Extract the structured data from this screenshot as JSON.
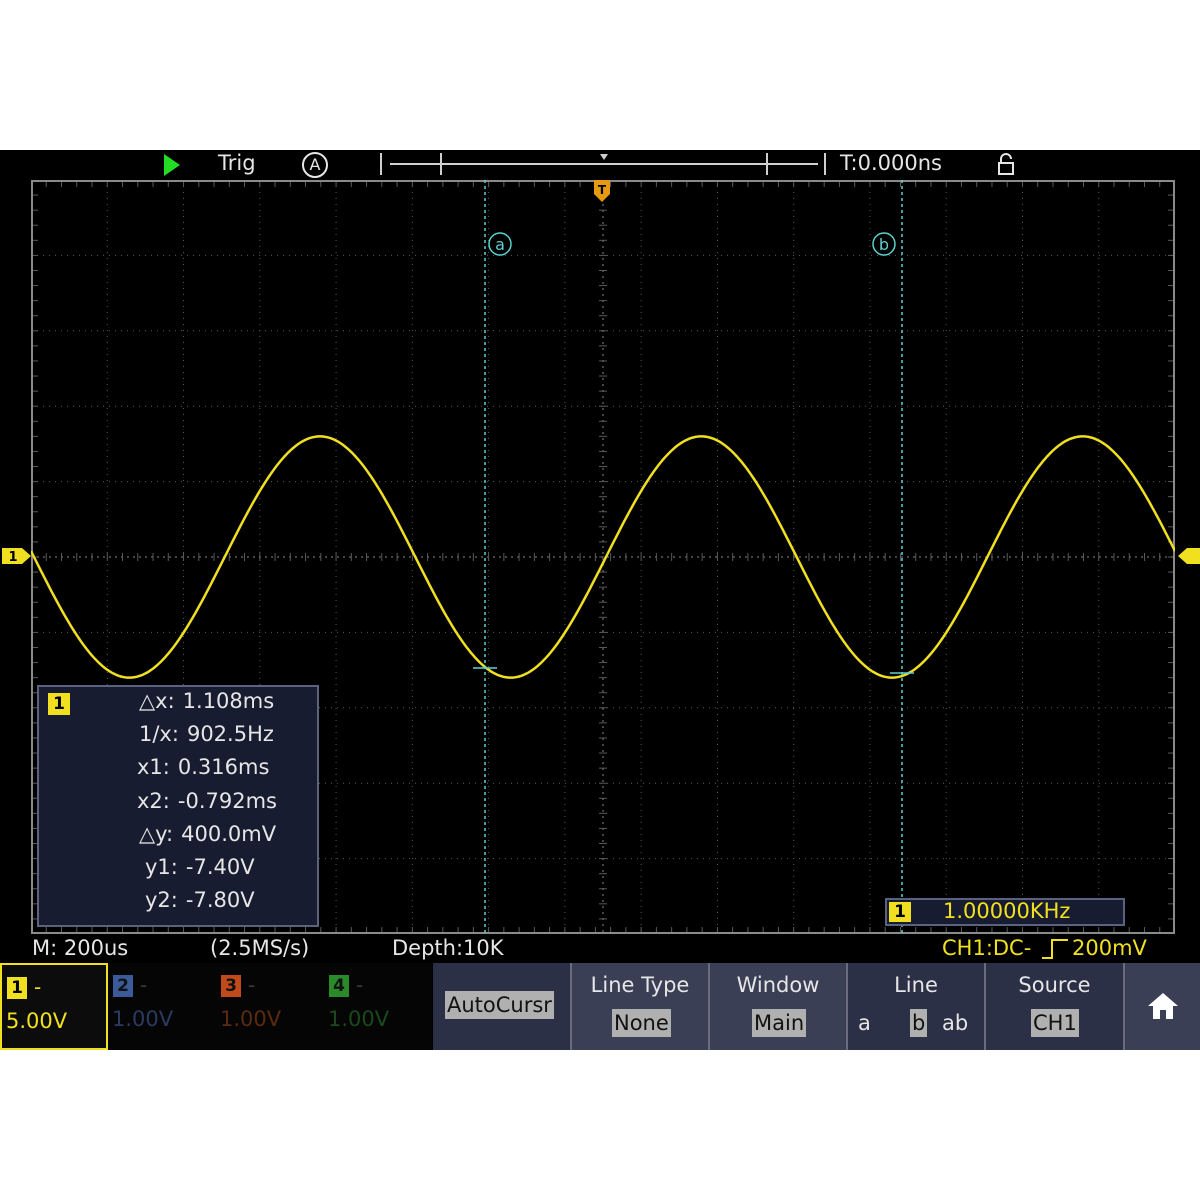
{
  "top_bar": {
    "trig_label": "Trig",
    "trig_mode_icon": "A",
    "time_delay": "T:0.000ns"
  },
  "cursors": {
    "a_label": "a",
    "b_label": "b"
  },
  "trigger_marker": "T",
  "channel_marker": "1",
  "measurement": {
    "channel": "1",
    "rows": [
      {
        "label": "△x:",
        "value": "1.108ms"
      },
      {
        "label": "1/x:",
        "value": "902.5Hz"
      },
      {
        "label": "x1:",
        "value": "0.316ms"
      },
      {
        "label": "x2:",
        "value": "-0.792ms"
      },
      {
        "label": "△y:",
        "value": "400.0mV"
      },
      {
        "label": "y1:",
        "value": "-7.40V"
      },
      {
        "label": "y2:",
        "value": "-7.80V"
      }
    ]
  },
  "frequency": {
    "channel": "1",
    "value": "1.00000KHz"
  },
  "status": {
    "timebase": "M: 200us",
    "sample_rate": "(2.5MS/s)",
    "depth": "Depth:10K",
    "trigger_prefix": "CH1:DC-",
    "trigger_level": "200mV"
  },
  "channels": [
    {
      "num": "1",
      "dash": "-",
      "value": "5.00V",
      "color": "#f0e020",
      "active": true
    },
    {
      "num": "2",
      "dash": "-",
      "value": "1.00V",
      "color": "#3a5a9a",
      "active": false
    },
    {
      "num": "3",
      "dash": "-",
      "value": "1.00V",
      "color": "#c04a1a",
      "active": false
    },
    {
      "num": "4",
      "dash": "-",
      "value": "1.00V",
      "color": "#2a8a2a",
      "active": false
    }
  ],
  "menu": {
    "auto_cursor": "AutoCursr",
    "line_type_title": "Line Type",
    "line_type_value": "None",
    "window_title": "Window",
    "window_value": "Main",
    "line_title": "Line",
    "line_options": [
      "a",
      "b",
      "ab"
    ],
    "line_selected": "b",
    "source_title": "Source",
    "source_value": "CH1"
  },
  "colors": {
    "trace": "#f0e020",
    "cursor": "#5fd0d0",
    "grid": "#5a5a5a",
    "menu_bg": "#2c3047",
    "run": "#22dd22"
  }
}
